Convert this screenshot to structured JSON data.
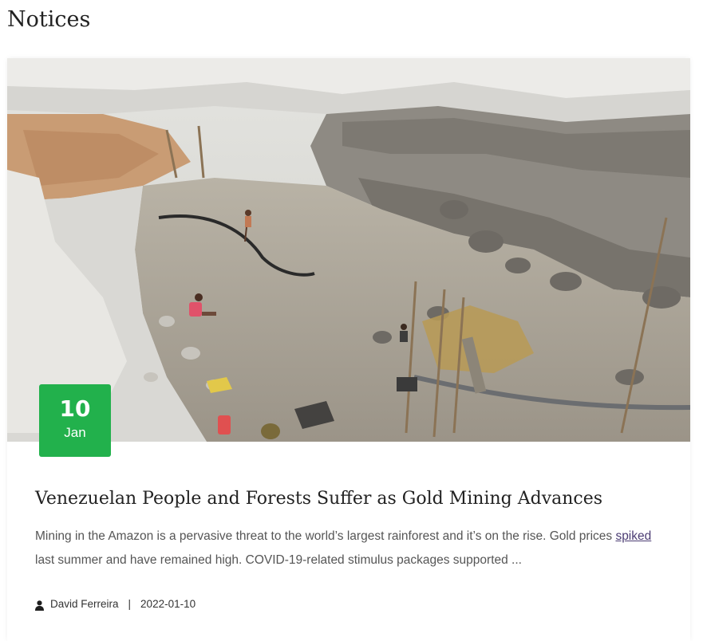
{
  "page": {
    "heading": "Notices"
  },
  "post": {
    "image_alt": "Open-pit gold mining site with workers",
    "date": {
      "day": "10",
      "month": "Jan"
    },
    "title": "Venezuelan People and Forests Suffer as Gold Mining Advances",
    "excerpt": {
      "before_link": "Mining in the Amazon is a pervasive threat to the world’s largest rainforest and it’s on the rise. Gold prices ",
      "link_text": "spiked",
      "after_link": " last summer and have remained high. COVID-19-related stimulus packages supported ..."
    },
    "author": "David Ferreira",
    "separator": "|",
    "published": "2022-01-10",
    "author_icon": "user-icon"
  },
  "colors": {
    "badge": "#22b14c",
    "heading": "#222222",
    "excerpt": "#555555",
    "link": "#4b3c73"
  }
}
